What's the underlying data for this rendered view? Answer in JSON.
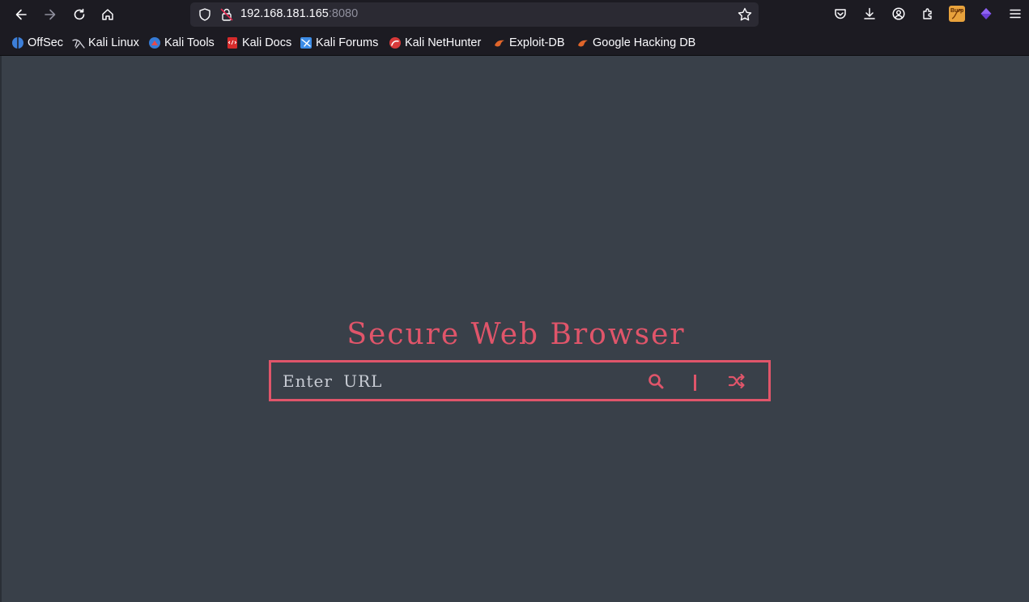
{
  "browser": {
    "url_host": "192.168.181.165",
    "url_port": ":8080",
    "extension_badge": "Burp"
  },
  "bookmarks": [
    {
      "label": "OffSec",
      "icon": "offsec-icon"
    },
    {
      "label": "Kali Linux",
      "icon": "kali-linux-icon"
    },
    {
      "label": "Kali Tools",
      "icon": "kali-tools-icon"
    },
    {
      "label": "Kali Docs",
      "icon": "kali-docs-icon"
    },
    {
      "label": "Kali Forums",
      "icon": "kali-forums-icon"
    },
    {
      "label": "Kali NetHunter",
      "icon": "kali-nethunter-icon"
    },
    {
      "label": "Exploit-DB",
      "icon": "exploit-db-icon"
    },
    {
      "label": "Google Hacking DB",
      "icon": "google-hacking-db-icon"
    }
  ],
  "page": {
    "title": "Secure Web Browser",
    "search_placeholder": "Enter URL",
    "accent_color": "#e0556a",
    "background_color": "#394049",
    "search_icon": "search-icon",
    "shuffle_icon": "shuffle-icon"
  }
}
